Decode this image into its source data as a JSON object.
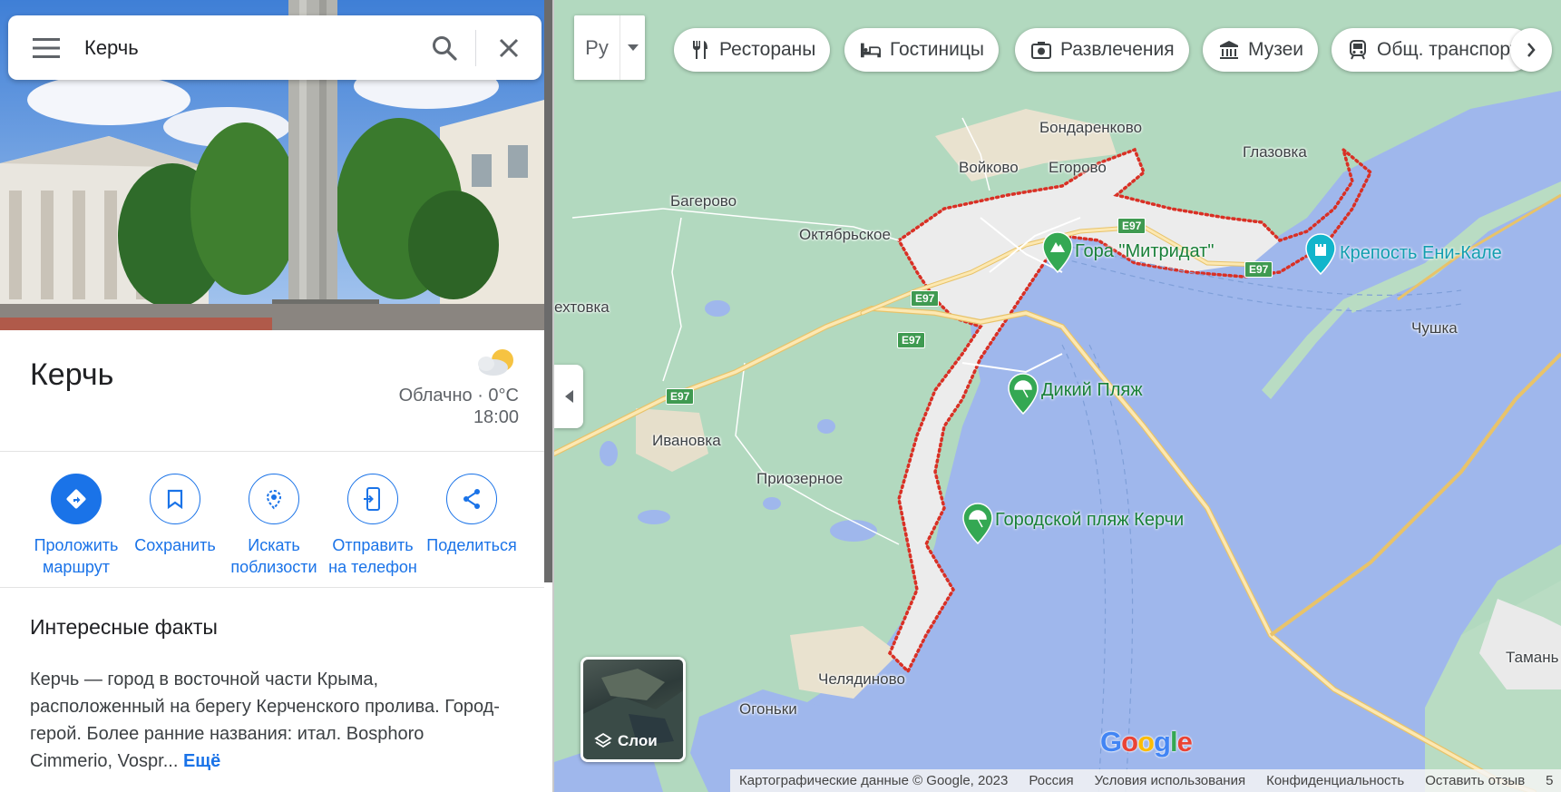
{
  "search": {
    "value": "Керчь",
    "menu_icon": "hamburger-menu-icon",
    "search_icon": "search-icon",
    "close_icon": "close-icon"
  },
  "place": {
    "title": "Керчь",
    "weather": {
      "condition": "Облачно · 0°C",
      "time": "18:00",
      "icon": "partly-cloudy-icon"
    }
  },
  "actions": [
    {
      "label_1": "Проложить",
      "label_2": "маршрут",
      "icon": "directions-icon"
    },
    {
      "label_1": "Сохранить",
      "label_2": "",
      "icon": "bookmark-icon"
    },
    {
      "label_1": "Искать",
      "label_2": "поблизости",
      "icon": "nearby-icon"
    },
    {
      "label_1": "Отправить",
      "label_2": "на телефон",
      "icon": "send-to-phone-icon"
    },
    {
      "label_1": "Поделиться",
      "label_2": "",
      "icon": "share-icon"
    }
  ],
  "facts": {
    "title": "Интересные факты",
    "body": "Керчь — город в восточной части Крыма, расположенный на берегу Керченского пролива. Город-герой. Более ранние названия: итал. Bosphoro Cimmerio, Vospr...",
    "more": "Ещё"
  },
  "map": {
    "language_button": "Ру",
    "chips": [
      {
        "label": "Рестораны",
        "icon": "restaurant-icon"
      },
      {
        "label": "Гостиницы",
        "icon": "hotel-icon"
      },
      {
        "label": "Развлечения",
        "icon": "camera-icon"
      },
      {
        "label": "Музеи",
        "icon": "museum-icon"
      },
      {
        "label": "Общ. транспорт",
        "icon": "transit-icon"
      }
    ],
    "places": {
      "bondarenkovo": "Бондаренково",
      "glazovka": "Глазовка",
      "voykovo": "Войково",
      "egorovo": "Егорово",
      "bagerovo": "Багерово",
      "oktyabrskoe": "Октябрьское",
      "ekhtovka": "ехтовка",
      "chushka": "Чушка",
      "ivanovka": "Ивановка",
      "priozernoe": "Приозерное",
      "chelyadinovo": "Челядиново",
      "ogonki": "Огоньки",
      "taman": "Тамань"
    },
    "pois": {
      "mitridat": "Гора \"Митридат\"",
      "yenikale": "Крепость Ени-Кале",
      "wild_beach": "Дикий Пляж",
      "city_beach": "Городской пляж Керчи"
    },
    "road_shield": "E97",
    "layers_label": "Слои",
    "logo": "Google",
    "attribution": {
      "copyright": "Картографические данные © Google, 2023",
      "country": "Россия",
      "terms": "Условия использования",
      "privacy": "Конфиденциальность",
      "feedback": "Оставить отзыв",
      "scale": "5"
    }
  },
  "colors": {
    "accent": "#1a73e8",
    "water": "#9fb7ec",
    "land": "#b2d9bf",
    "city_border": "#d93025",
    "poi_green": "#188038",
    "poi_teal": "#129eaf",
    "road": "#f8d98a"
  }
}
